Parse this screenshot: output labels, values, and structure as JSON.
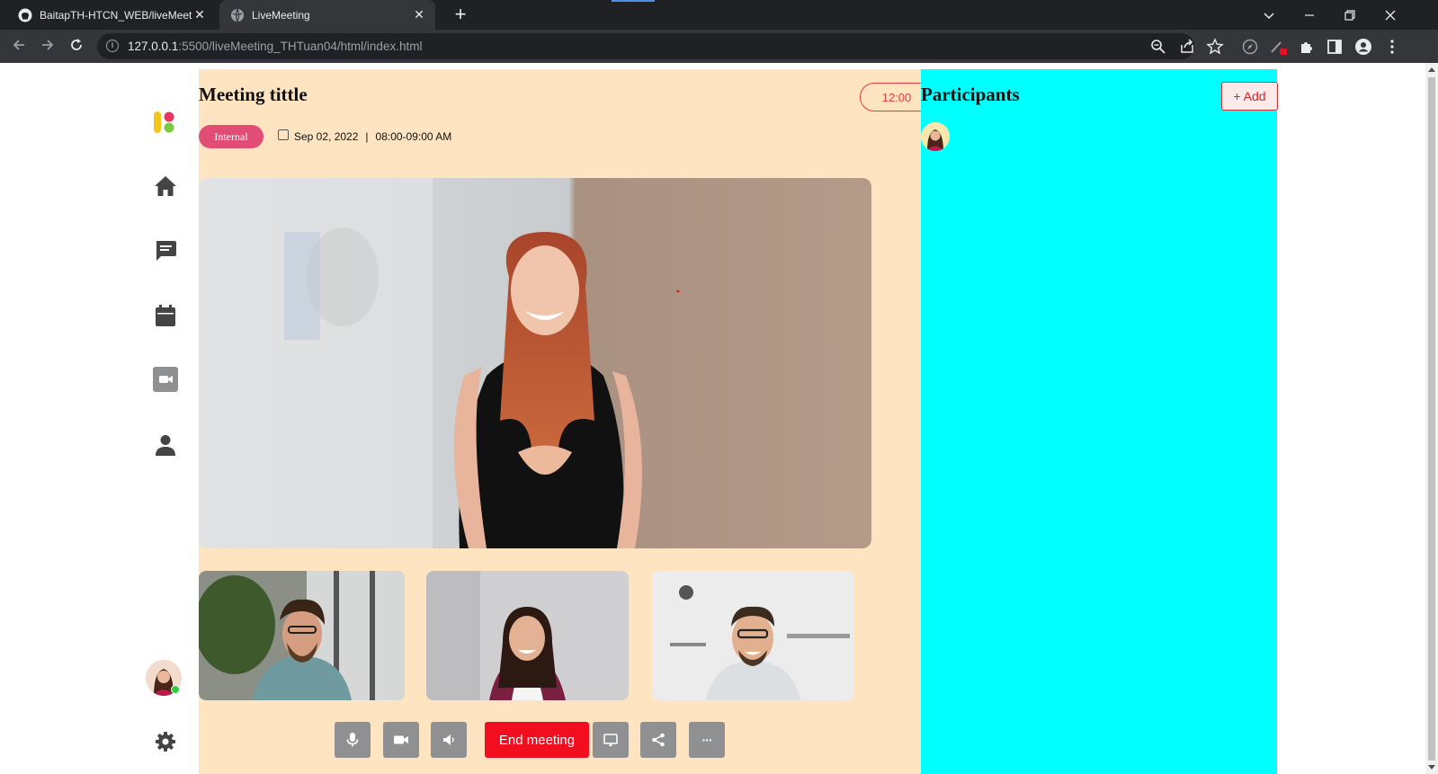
{
  "browser": {
    "tabs": [
      {
        "title": "BaitapTH-HTCN_WEB/liveMeeting",
        "icon": "github-icon"
      },
      {
        "title": "LiveMeeting",
        "icon": "globe-icon"
      }
    ],
    "close_glyph": "✕",
    "new_tab_glyph": "+",
    "url_host": "127.0.0.1",
    "url_rest": ":5500/liveMeeting_THTuan04/html/index.html"
  },
  "sidebar": {
    "items": [
      {
        "name": "home-icon"
      },
      {
        "name": "chat-icon"
      },
      {
        "name": "calendar-icon"
      },
      {
        "name": "video-icon"
      },
      {
        "name": "user-icon"
      }
    ],
    "settings_icon": "gear-icon"
  },
  "meeting": {
    "title": "Meeting tittle",
    "time": "12:00",
    "tag": "Internal",
    "date": "Sep 02, 2022",
    "separator": "|",
    "hours": "08:00-09:00 AM"
  },
  "controls": {
    "end_label": "End meeting",
    "more_glyph": "···"
  },
  "participants": {
    "title": "Participants",
    "add_label": "+ Add"
  },
  "colors": {
    "main_bg": "#fee4c0",
    "panel_bg": "#00ffff",
    "end_button": "#f20d1f",
    "tag": "#e24d76"
  }
}
